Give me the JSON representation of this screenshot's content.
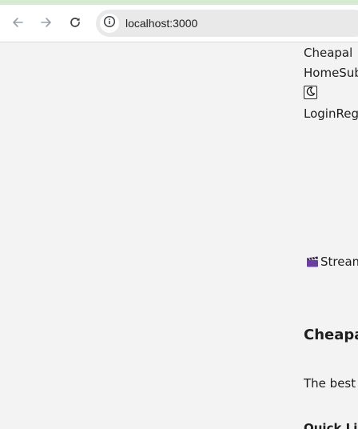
{
  "browser": {
    "url": "localhost:3000",
    "back_icon": "back-arrow-icon",
    "forward_icon": "forward-arrow-icon",
    "reload_icon": "reload-icon",
    "site_info_icon": "info-icon"
  },
  "page": {
    "brand": "Cheapal",
    "nav_links": "HomeSub",
    "theme_toggle_icon": "moon-icon",
    "auth_links": "LoginReg",
    "hero_text": "Stream",
    "hero_icon": "clapper-board-icon",
    "footer_title": "Cheapal",
    "footer_text": "The best r",
    "quick_links_heading": "Quick Lin"
  }
}
